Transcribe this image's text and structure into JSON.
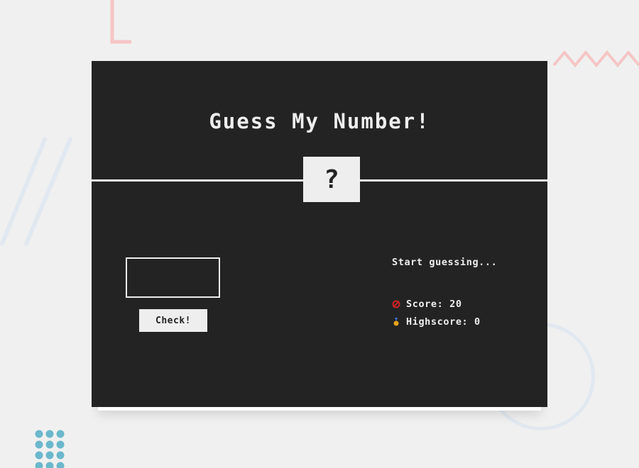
{
  "game": {
    "title": "Guess My Number!",
    "secret_display": "?",
    "guess_input": {
      "value": "",
      "placeholder": ""
    },
    "check_label": "Check!",
    "message": "Start guessing...",
    "score": {
      "icon": "score-icon",
      "label": "Score:",
      "value": "20"
    },
    "highscore": {
      "icon": "highscore-icon",
      "label": "Highscore:",
      "value": "0"
    }
  },
  "colors": {
    "page_background": "#f0f0f0",
    "board_background": "#232323",
    "foreground": "#eeeeee",
    "score_icon": "#cc2222",
    "highscore_icon": "#e8a317",
    "deco_pink": "#f6c5c5",
    "deco_blue": "#e2e8ef",
    "deco_teal": "#6bb8cc"
  }
}
